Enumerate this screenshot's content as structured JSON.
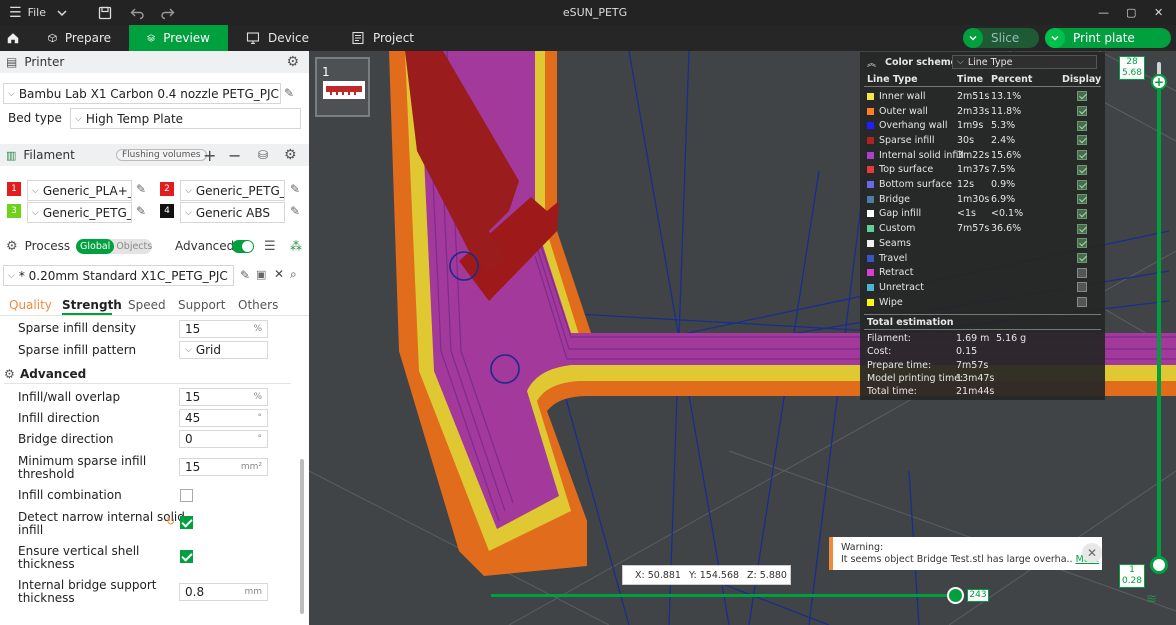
{
  "titlebar": {
    "menu_label": "File",
    "window_title": "eSUN_PETG",
    "minimize": "—",
    "maximize": "▢",
    "close": "✕"
  },
  "tabs": [
    {
      "label": "Prepare",
      "icon": "prepare-cube-icon"
    },
    {
      "label": "Preview",
      "icon": "preview-layers-icon",
      "active": true
    },
    {
      "label": "Device",
      "icon": "device-monitor-icon"
    },
    {
      "label": "Project",
      "icon": "project-document-icon"
    }
  ],
  "actions": {
    "slice_label": "Slice",
    "print_label": "Print plate"
  },
  "printer": {
    "section_title": "Printer",
    "name": "Bambu Lab X1 Carbon 0.4 nozzle PETG_PJC",
    "bed_type_label": "Bed type",
    "bed_type_value": "High Temp Plate"
  },
  "filament": {
    "section_title": "Filament",
    "flushing_label": "Flushing volumes",
    "items": [
      {
        "index": "1",
        "name": "Generic_PLA+_eS...",
        "color": "#e11d1d"
      },
      {
        "index": "2",
        "name": "Generic_PETG_eS...",
        "color": "#e11d1d"
      },
      {
        "index": "3",
        "name": "Generic_PETG_eS...",
        "color": "#6fd11a"
      },
      {
        "index": "4",
        "name": "Generic ABS",
        "color": "#111111"
      }
    ]
  },
  "process": {
    "section_title": "Process",
    "toggle_global": "Global",
    "toggle_objects": "Objects",
    "advanced_label": "Advanced",
    "preset": "* 0.20mm Standard X1C_PETG_PJC",
    "tabs": [
      "Quality",
      "Strength",
      "Speed",
      "Support",
      "Others"
    ],
    "active_tab": "Strength",
    "settings": {
      "sparse_density_label": "Sparse infill density",
      "sparse_density_value": "15",
      "sparse_density_unit": "%",
      "sparse_pattern_label": "Sparse infill pattern",
      "sparse_pattern_value": "Grid",
      "advanced_heading": "Advanced",
      "overlap_label": "Infill/wall overlap",
      "overlap_value": "15",
      "overlap_unit": "%",
      "direction_label": "Infill direction",
      "direction_value": "45",
      "direction_unit": "°",
      "bridge_dir_label": "Bridge direction",
      "bridge_dir_value": "0",
      "bridge_dir_unit": "°",
      "min_sparse_label_1": "Minimum sparse infill",
      "min_sparse_label_2": "threshold",
      "min_sparse_value": "15",
      "min_sparse_unit": "mm²",
      "combination_label": "Infill combination",
      "combination_checked": false,
      "narrow_label_1": "Detect narrow internal solid",
      "narrow_label_2": "infill",
      "narrow_checked": true,
      "vshell_label_1": "Ensure vertical shell",
      "vshell_label_2": "thickness",
      "vshell_checked": true,
      "bridge_support_label_1": "Internal bridge support",
      "bridge_support_label_2": "thickness",
      "bridge_support_value": "0.8",
      "bridge_support_unit": "mm"
    }
  },
  "plate": {
    "number": "1"
  },
  "legend": {
    "color_scheme_label": "Color scheme",
    "color_scheme_value": "Line Type",
    "col_line_type": "Line Type",
    "col_time": "Time",
    "col_percent": "Percent",
    "col_display": "Display",
    "rows": [
      {
        "name": "Inner wall",
        "time": "2m51s",
        "percent": "13.1%",
        "color": "#f5e64a",
        "display": true
      },
      {
        "name": "Outer wall",
        "time": "2m33s",
        "percent": "11.8%",
        "color": "#ff7f1e",
        "display": true
      },
      {
        "name": "Overhang wall",
        "time": "1m9s",
        "percent": "5.3%",
        "color": "#2020ff",
        "display": true
      },
      {
        "name": "Sparse infill",
        "time": "30s",
        "percent": "2.4%",
        "color": "#b02222",
        "display": true
      },
      {
        "name": "Internal solid infill",
        "time": "3m22s",
        "percent": "15.6%",
        "color": "#a742c9",
        "display": true
      },
      {
        "name": "Top surface",
        "time": "1m37s",
        "percent": "7.5%",
        "color": "#e83a3a",
        "display": true
      },
      {
        "name": "Bottom surface",
        "time": "12s",
        "percent": "0.9%",
        "color": "#6a6ae8",
        "display": true
      },
      {
        "name": "Bridge",
        "time": "1m30s",
        "percent": "6.9%",
        "color": "#4e7ea8",
        "display": true
      },
      {
        "name": "Gap infill",
        "time": "<1s",
        "percent": "<0.1%",
        "color": "#ffffff",
        "display": true
      },
      {
        "name": "Custom",
        "time": "7m57s",
        "percent": "36.6%",
        "color": "#5ecf98",
        "display": true
      },
      {
        "name": "Seams",
        "time": "",
        "percent": "",
        "color": "#f0f0f0",
        "display": true
      },
      {
        "name": "Travel",
        "time": "",
        "percent": "",
        "color": "#3a55c0",
        "display": true
      },
      {
        "name": "Retract",
        "time": "",
        "percent": "",
        "color": "#d93fd0",
        "display": false
      },
      {
        "name": "Unretract",
        "time": "",
        "percent": "",
        "color": "#4ab6d6",
        "display": false
      },
      {
        "name": "Wipe",
        "time": "",
        "percent": "",
        "color": "#f7f71e",
        "display": false
      }
    ],
    "total_title": "Total estimation",
    "filament_label": "Filament:",
    "filament_length": "1.69 m",
    "filament_weight": "5.16 g",
    "cost_label": "Cost:",
    "cost_value": "0.15",
    "prepare_label": "Prepare time:",
    "prepare_value": "7m57s",
    "model_label": "Model printing time:",
    "model_value": "13m47s",
    "total_label": "Total time:",
    "total_value": "21m44s"
  },
  "layer_slider": {
    "top_layer": "28",
    "top_height": "5.68",
    "bottom_layer": "1",
    "bottom_height": "0.28",
    "top_fraction": 0.96
  },
  "move_slider": {
    "value": "243",
    "fraction": 1.0
  },
  "warning": {
    "title": "Warning:",
    "message": "It seems object Bridge Test.stl has large overha..",
    "more_label": "More"
  },
  "coords": {
    "x": "X: 50.881",
    "y": "Y: 154.568",
    "z": "Z: 5.880"
  }
}
